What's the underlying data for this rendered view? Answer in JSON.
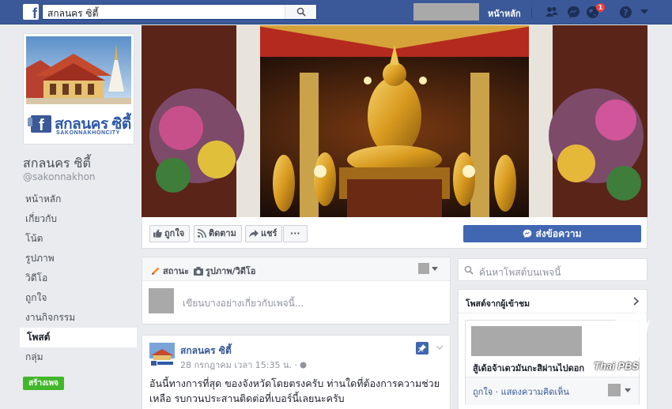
{
  "topbar": {
    "logo": "f",
    "search_value": "สกลนคร ซิตี้",
    "home_label": "หน้าหลัก",
    "notification_count": "1",
    "colors": {
      "bar": "#3b5998",
      "badge": "#fa3e3e"
    },
    "icons": [
      "facebook-logo-icon",
      "search-icon",
      "friends-icon",
      "messenger-icon",
      "globe-icon",
      "help-icon",
      "caret-down-icon"
    ]
  },
  "profile": {
    "brand_text": "สกลนคร ซิตี้",
    "brand_sub": "SAKONNAKHONCITY"
  },
  "page": {
    "name": "สกลนคร ซิตี้",
    "handle": "@sakonnakhon"
  },
  "nav": {
    "items": [
      "หน้าหลัก",
      "เกี่ยวกับ",
      "โน้ต",
      "รูปภาพ",
      "วิดีโอ",
      "ถูกใจ",
      "งานกิจกรรม",
      "โพสต์",
      "กลุ่ม"
    ],
    "active": "โพสต์",
    "create_page": "สร้างเพจ"
  },
  "actions": {
    "like": "ถูกใจ",
    "follow": "ติดตาม",
    "share": "แชร์",
    "more": "···",
    "send_message": "ส่งข้อความ"
  },
  "composer": {
    "tab_status": "สถานะ",
    "tab_photo": "รูปภาพ/วิดีโอ",
    "placeholder": "เขียนบางอย่างเกี่ยวกับเพจนี้..."
  },
  "post": {
    "author": "สกลนคร ซิตี้",
    "meta": "28 กรกฎาคม เวลา 15:35 น. ·",
    "text": "อันนี้ทางการที่สุด ของจังหวัดโดยตรงครับ ท่านใดที่ต้องการความช่วยเหลือ รบกวนประสานติดต่อที่เบอร์นี้เลยนะครับ"
  },
  "right": {
    "search_placeholder": "ค้นหาโพสต์บนเพจนี้",
    "visitor_title": "โพสต์จากผู้เข้าชม",
    "visitor_snippet": "สู้เด้อจ้าเดวมันกะสิผ่านไปดอก",
    "visitor_like": "ถูกใจ",
    "visitor_comment": "แสดงความคิดเห็น"
  },
  "watermark": {
    "text": "Thai PBS"
  }
}
